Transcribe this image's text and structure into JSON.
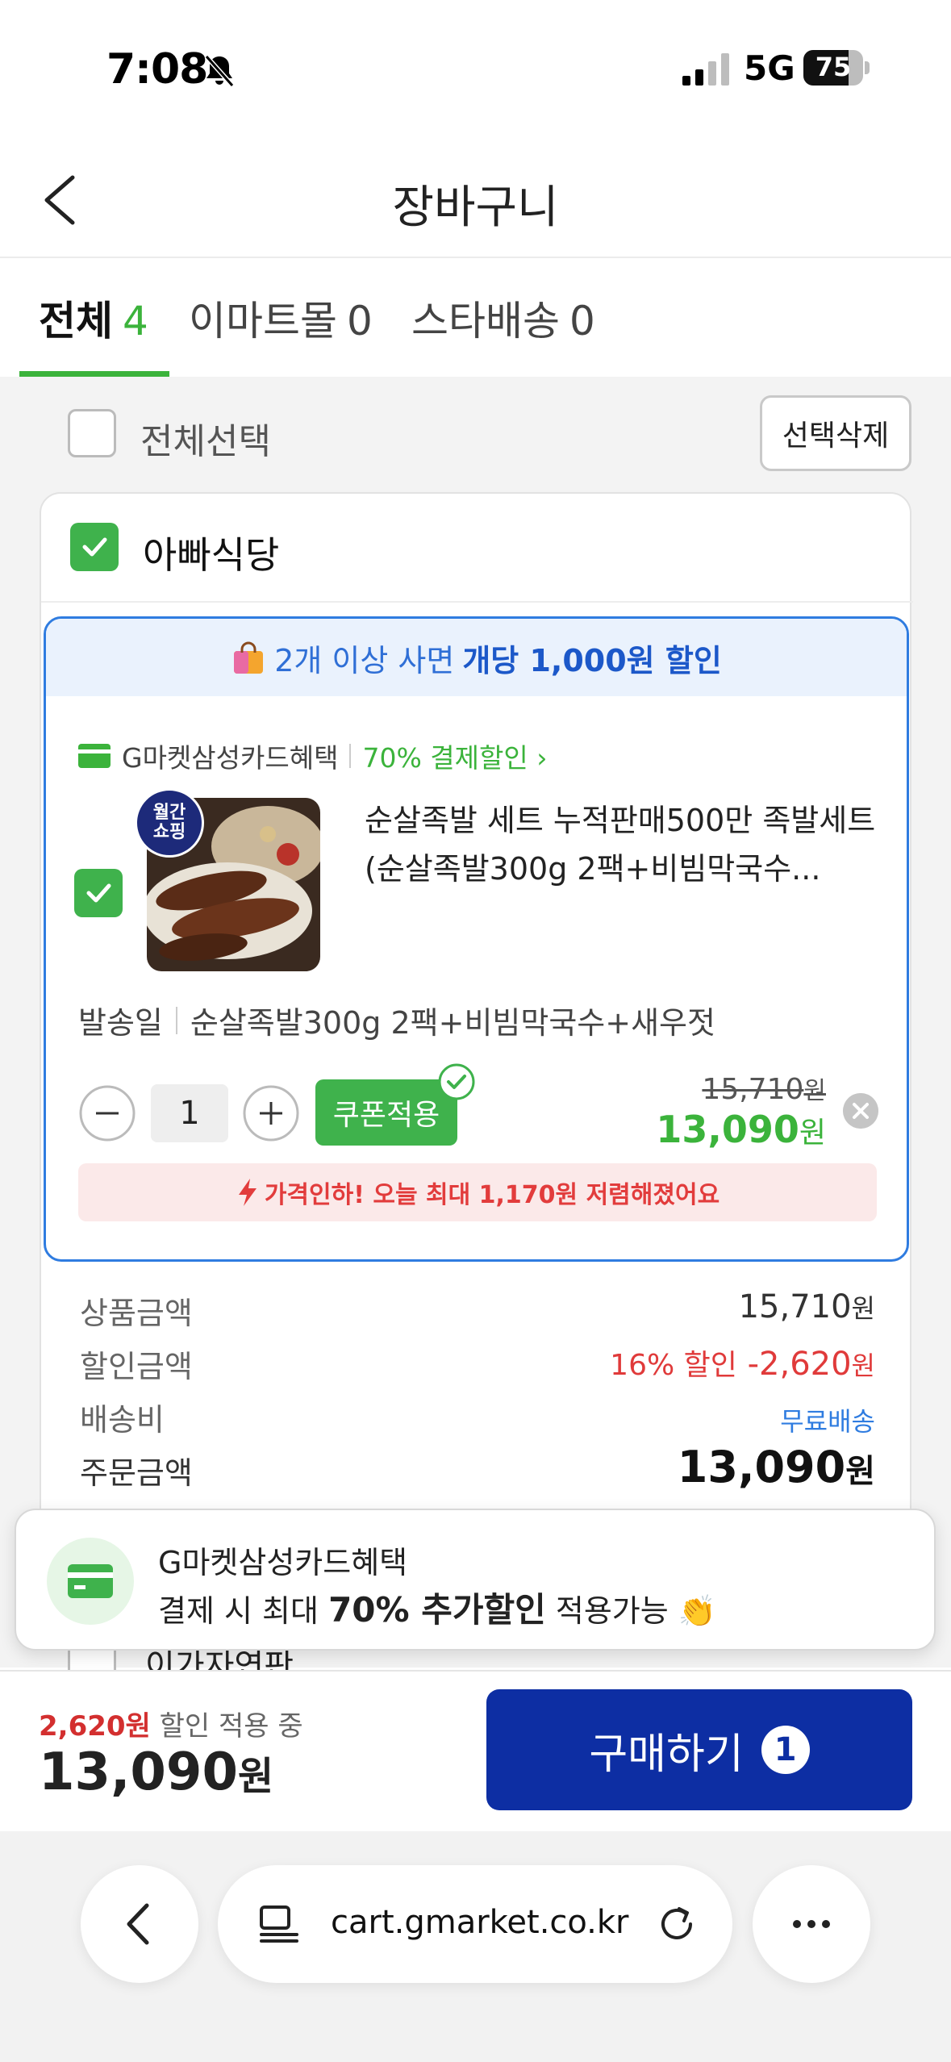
{
  "status_bar": {
    "time": "7:08",
    "network": "5G",
    "battery": "75",
    "battery_level": 0.75
  },
  "header": {
    "title": "장바구니"
  },
  "tabs": [
    {
      "label": "전체",
      "count": "4",
      "active": true
    },
    {
      "label": "이마트몰",
      "count": "0",
      "active": false
    },
    {
      "label": "스타배송",
      "count": "0",
      "active": false
    }
  ],
  "select_all": {
    "label": "전체선택",
    "checked": false,
    "delete_label": "선택삭제"
  },
  "store": {
    "name": "아빠식당",
    "checked": true,
    "promo": {
      "text": "2개 이상 사면",
      "bold": "개당 1,000원 할인"
    },
    "card_benefit": {
      "name": "G마켓삼성카드혜택",
      "offer": "70% 결제할인 ›"
    },
    "item": {
      "badge_line1": "월간",
      "badge_line2": "쇼핑",
      "title": "순살족발 세트 누적판매500만 족발세트(순살족발300g 2팩+비빔막국수...",
      "option_label": "발송일",
      "option_value": "순살족발300g 2팩+비빔막국수+새우젓",
      "quantity": "1",
      "coupon_label": "쿠폰적용",
      "original_price": "15,710",
      "sale_price": "13,090",
      "won": "원",
      "price_drop": "가격인하! 오늘 최대 1,170원 저렴해졌어요"
    },
    "summary": {
      "product_label": "상품금액",
      "product_value": "15,710",
      "discount_label": "할인금액",
      "discount_pct": "16% 할인",
      "discount_value": "-2,620",
      "shipping_label": "배송비",
      "shipping_value": "무료배송",
      "order_label": "주문금액",
      "order_value": "13,090"
    }
  },
  "hidden_row": {
    "label": "이가자연판"
  },
  "toast": {
    "title": "G마켓삼성카드혜택",
    "body_pre": "결제 시 최대",
    "body_bold": "70% 추가할인",
    "body_post": "적용가능 👏"
  },
  "bottom": {
    "discount_amount": "2,620원",
    "discount_suffix": "할인 적용 중",
    "total": "13,090",
    "won": "원",
    "buy_label": "구매하기",
    "buy_count": "1"
  },
  "browser": {
    "url": "cart.gmarket.co.kr"
  },
  "colors": {
    "accent_green": "#3bb33b",
    "buy_blue": "#0d2ea3",
    "promo_blue": "#2f7ce0",
    "discount_red": "#e03a3a"
  }
}
